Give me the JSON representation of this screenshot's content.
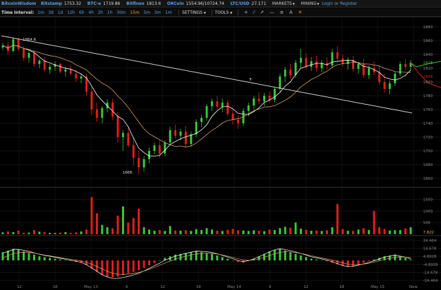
{
  "header": {
    "logo": "BitcoinWisdom",
    "tickers": [
      {
        "exchange": "Bitstamp",
        "price": "1753.32"
      },
      {
        "exchange": "BTC-e",
        "price": "1719.86"
      },
      {
        "exchange": "Bitfinex",
        "price": "1813.6"
      },
      {
        "exchange": "OKCoin",
        "price": "1554.96/10724.74"
      },
      {
        "exchange": "LTC/USD",
        "price": "27.171"
      }
    ],
    "markets_label": "MARKETS",
    "mining_label": "MINING",
    "login_label": "Login",
    "or_label": "or",
    "register_label": "Register"
  },
  "toolbar": {
    "interval_label": "Time Interval:",
    "intervals": [
      "1m",
      "3d",
      "1d",
      "12h",
      "6h",
      "4h",
      "2h",
      "1h",
      "30m",
      "15m",
      "5m",
      "3m",
      "1m"
    ],
    "active_interval": "15m",
    "settings_label": "SETTINGS",
    "tools_label": "TOOLS",
    "tool_icons": [
      "crosshair-icon",
      "line-icon",
      "ray-icon",
      "horizontal-line-icon",
      "fibonacci-icon",
      "text-icon",
      "delete-icon"
    ]
  },
  "colors": {
    "up": "#3cc83c",
    "down": "#e0201c",
    "ma_fast": "#ffffff",
    "ma_slow": "#d9a060",
    "trendline": "#cfcfcf",
    "accent": "#5aa0e8"
  },
  "chart_data": {
    "type": "candlestick",
    "price_axis": {
      "ticks": [
        "1880",
        "1860",
        "1840",
        "1820",
        "1800",
        "1780",
        "1760",
        "1740",
        "1720",
        "1700",
        "1680",
        "1660"
      ],
      "ylim": [
        1649,
        1891
      ]
    },
    "annotations": {
      "high_label": "1864.6",
      "low_label": "1666"
    },
    "current_price_green": "1828",
    "current_price_red": "1808",
    "volume_axis": {
      "ticks": [
        "1500",
        "1000",
        "500"
      ],
      "current": "7.822",
      "ylim": [
        0,
        1900
      ]
    },
    "macd_axis": {
      "ticks": [
        "24.464",
        "14.678",
        "4.8928",
        "-4.8928",
        "-14.678",
        "-24.464"
      ],
      "ylim": [
        -27,
        27
      ]
    },
    "time_axis": [
      "12",
      "18",
      "May 13",
      "6",
      "12",
      "18",
      "May 14",
      "6",
      "12",
      "18",
      "May 15",
      "Now"
    ],
    "candles": [
      [
        1850,
        1857,
        1846,
        1853
      ],
      [
        1853,
        1858,
        1840,
        1845
      ],
      [
        1845,
        1865,
        1843,
        1862
      ],
      [
        1862,
        1864.6,
        1844,
        1848
      ],
      [
        1848,
        1852,
        1830,
        1835
      ],
      [
        1835,
        1845,
        1828,
        1842
      ],
      [
        1842,
        1846,
        1822,
        1826
      ],
      [
        1826,
        1834,
        1820,
        1831
      ],
      [
        1831,
        1836,
        1815,
        1818
      ],
      [
        1818,
        1826,
        1812,
        1822
      ],
      [
        1822,
        1830,
        1816,
        1826
      ],
      [
        1826,
        1828,
        1812,
        1815
      ],
      [
        1815,
        1822,
        1808,
        1818
      ],
      [
        1818,
        1824,
        1810,
        1812
      ],
      [
        1812,
        1818,
        1800,
        1805
      ],
      [
        1805,
        1812,
        1798,
        1808
      ],
      [
        1808,
        1812,
        1780,
        1786
      ],
      [
        1786,
        1792,
        1752,
        1760
      ],
      [
        1760,
        1770,
        1742,
        1748
      ],
      [
        1748,
        1765,
        1740,
        1762
      ],
      [
        1762,
        1775,
        1756,
        1770
      ],
      [
        1770,
        1776,
        1745,
        1750
      ],
      [
        1750,
        1756,
        1712,
        1720
      ],
      [
        1720,
        1730,
        1700,
        1726
      ],
      [
        1726,
        1734,
        1705,
        1708
      ],
      [
        1708,
        1718,
        1680,
        1690
      ],
      [
        1690,
        1700,
        1666,
        1676
      ],
      [
        1676,
        1692,
        1670,
        1688
      ],
      [
        1688,
        1705,
        1682,
        1700
      ],
      [
        1700,
        1712,
        1695,
        1708
      ],
      [
        1708,
        1716,
        1690,
        1696
      ],
      [
        1696,
        1715,
        1692,
        1712
      ],
      [
        1712,
        1735,
        1708,
        1730
      ],
      [
        1730,
        1738,
        1718,
        1722
      ],
      [
        1722,
        1732,
        1715,
        1728
      ],
      [
        1728,
        1736,
        1705,
        1710
      ],
      [
        1710,
        1728,
        1706,
        1724
      ],
      [
        1724,
        1746,
        1720,
        1742
      ],
      [
        1742,
        1752,
        1735,
        1748
      ],
      [
        1748,
        1768,
        1744,
        1765
      ],
      [
        1765,
        1776,
        1758,
        1772
      ],
      [
        1772,
        1780,
        1760,
        1764
      ],
      [
        1764,
        1776,
        1756,
        1770
      ],
      [
        1770,
        1774,
        1750,
        1754
      ],
      [
        1754,
        1760,
        1738,
        1745
      ],
      [
        1745,
        1752,
        1732,
        1740
      ],
      [
        1740,
        1762,
        1736,
        1758
      ],
      [
        1758,
        1770,
        1750,
        1766
      ],
      [
        1766,
        1780,
        1760,
        1776
      ],
      [
        1776,
        1785,
        1768,
        1772
      ],
      [
        1772,
        1784,
        1765,
        1780
      ],
      [
        1780,
        1786,
        1770,
        1774
      ],
      [
        1774,
        1792,
        1770,
        1790
      ],
      [
        1790,
        1812,
        1786,
        1808
      ],
      [
        1808,
        1822,
        1800,
        1818
      ],
      [
        1818,
        1826,
        1805,
        1810
      ],
      [
        1810,
        1832,
        1806,
        1828
      ],
      [
        1828,
        1848,
        1820,
        1835
      ],
      [
        1835,
        1842,
        1818,
        1822
      ],
      [
        1822,
        1836,
        1816,
        1830
      ],
      [
        1830,
        1838,
        1815,
        1820
      ],
      [
        1820,
        1832,
        1814,
        1828
      ],
      [
        1828,
        1836,
        1818,
        1824
      ],
      [
        1824,
        1848,
        1820,
        1843
      ],
      [
        1843,
        1852,
        1830,
        1834
      ],
      [
        1834,
        1840,
        1822,
        1826
      ],
      [
        1826,
        1836,
        1818,
        1832
      ],
      [
        1832,
        1838,
        1815,
        1819
      ],
      [
        1819,
        1828,
        1812,
        1826
      ],
      [
        1826,
        1834,
        1806,
        1810
      ],
      [
        1810,
        1824,
        1804,
        1820
      ],
      [
        1820,
        1830,
        1810,
        1814
      ],
      [
        1814,
        1824,
        1796,
        1800
      ],
      [
        1800,
        1812,
        1785,
        1790
      ],
      [
        1790,
        1802,
        1782,
        1798
      ],
      [
        1798,
        1815,
        1794,
        1812
      ],
      [
        1812,
        1830,
        1808,
        1826
      ],
      [
        1826,
        1834,
        1818,
        1822
      ],
      [
        1822,
        1832,
        1816,
        1828
      ]
    ],
    "volumes": [
      80,
      120,
      90,
      150,
      60,
      70,
      180,
      110,
      90,
      60,
      50,
      70,
      90,
      60,
      80,
      120,
      200,
      1600,
      900,
      400,
      300,
      250,
      800,
      1200,
      500,
      700,
      1100,
      300,
      200,
      150,
      180,
      140,
      350,
      160,
      150,
      170,
      140,
      220,
      180,
      260,
      200,
      150,
      140,
      190,
      230,
      170,
      160,
      140,
      170,
      150,
      130,
      200,
      180,
      260,
      320,
      280,
      500,
      240,
      190,
      150,
      160,
      140,
      170,
      300,
      1300,
      220,
      150,
      140,
      200,
      260,
      180,
      1000,
      300,
      230,
      160,
      170,
      180,
      250,
      300
    ],
    "macd_hist": [
      10,
      12,
      14,
      13,
      11,
      9,
      7,
      5,
      4,
      3,
      2,
      1,
      0,
      -1,
      -2,
      -3,
      -6,
      -10,
      -14,
      -18,
      -20,
      -21,
      -20,
      -18,
      -16,
      -14,
      -12,
      -9,
      -6,
      -3,
      0,
      3,
      5,
      7,
      8,
      9,
      10,
      11,
      10,
      9,
      8,
      6,
      4,
      2,
      0,
      -2,
      -3,
      -1,
      2,
      5,
      8,
      11,
      13,
      14,
      12,
      10,
      8,
      6,
      4,
      2,
      1,
      0,
      -1,
      -3,
      -5,
      -7,
      -8,
      -7,
      -5,
      -3,
      -1,
      1,
      3,
      5,
      6,
      7,
      5,
      3,
      1
    ]
  }
}
